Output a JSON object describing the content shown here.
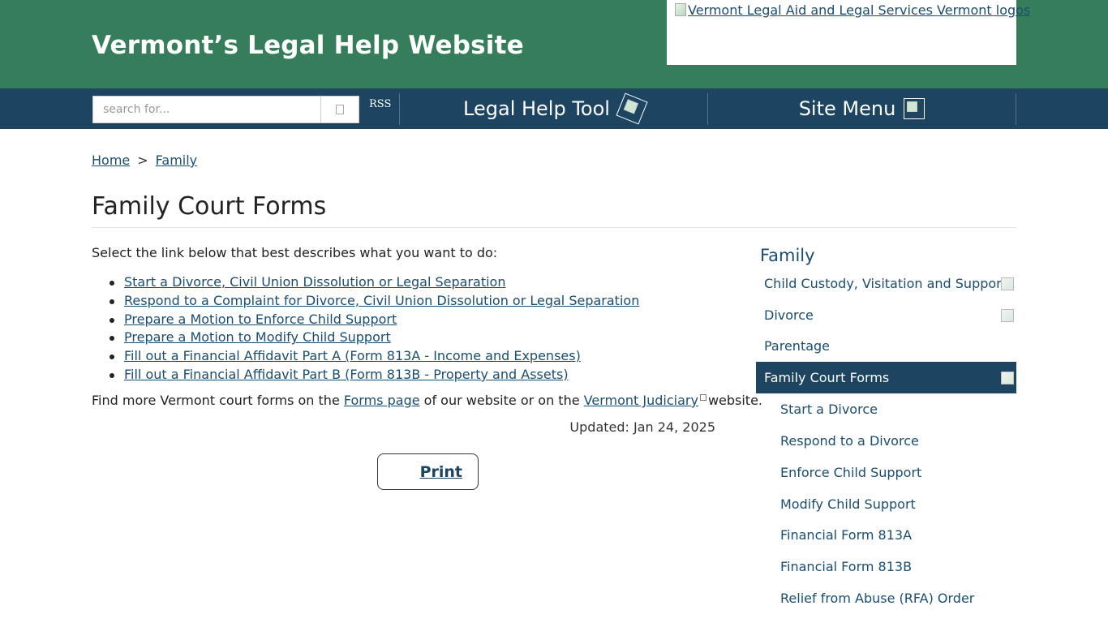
{
  "header": {
    "site_title": "Vermont’s Legal Help Website",
    "logo_alt": "Vermont Legal Aid and Legal Services Vermont logos"
  },
  "nav": {
    "search_placeholder": "search for...",
    "search_icon": "search-icon",
    "rss_alt": "RSS",
    "legal_help_tool": "Legal Help Tool",
    "site_menu": "Site Menu"
  },
  "breadcrumb": {
    "home": "Home",
    "separator": ">",
    "current": "Family"
  },
  "main": {
    "title": "Family Court Forms",
    "intro": "Select the link below that best describes what you want to do:",
    "links": [
      "Start a Divorce, Civil Union Dissolution or Legal Separation",
      "Respond to a Complaint for Divorce, Civil Union Dissolution or Legal Separation",
      "Prepare a Motion to Enforce Child Support",
      "Prepare a Motion to Modify Child Support",
      "Fill out a Financial Affidavit Part A (Form 813A - Income and Expenses)",
      "Fill out a Financial Affidavit Part B (Form 813B - Property and Assets)"
    ],
    "more_prefix": "Find more Vermont court forms on the",
    "forms_page_link": "Forms page",
    "more_middle": "of our website or on the",
    "judiciary_link": "Vermont Judiciary",
    "more_suffix": "website.",
    "updated": "Updated: Jan 24, 2025",
    "print_label": "Print"
  },
  "sidebar": {
    "heading": "Family",
    "items": [
      {
        "label": "Child Custody, Visitation and Support"
      },
      {
        "label": "Divorce"
      },
      {
        "label": "Parentage"
      },
      {
        "label": "Family Court Forms"
      },
      {
        "label": "Start a Divorce"
      },
      {
        "label": "Respond to a Divorce"
      },
      {
        "label": "Enforce Child Support"
      },
      {
        "label": "Modify Child Support"
      },
      {
        "label": "Financial Form 813A"
      },
      {
        "label": "Financial Form 813B"
      },
      {
        "label": "Relief from Abuse (RFA) Order"
      }
    ]
  },
  "colors": {
    "header_green": "#367e5b",
    "nav_navy": "#1d4460",
    "link_blue": "#1a4d6e"
  }
}
